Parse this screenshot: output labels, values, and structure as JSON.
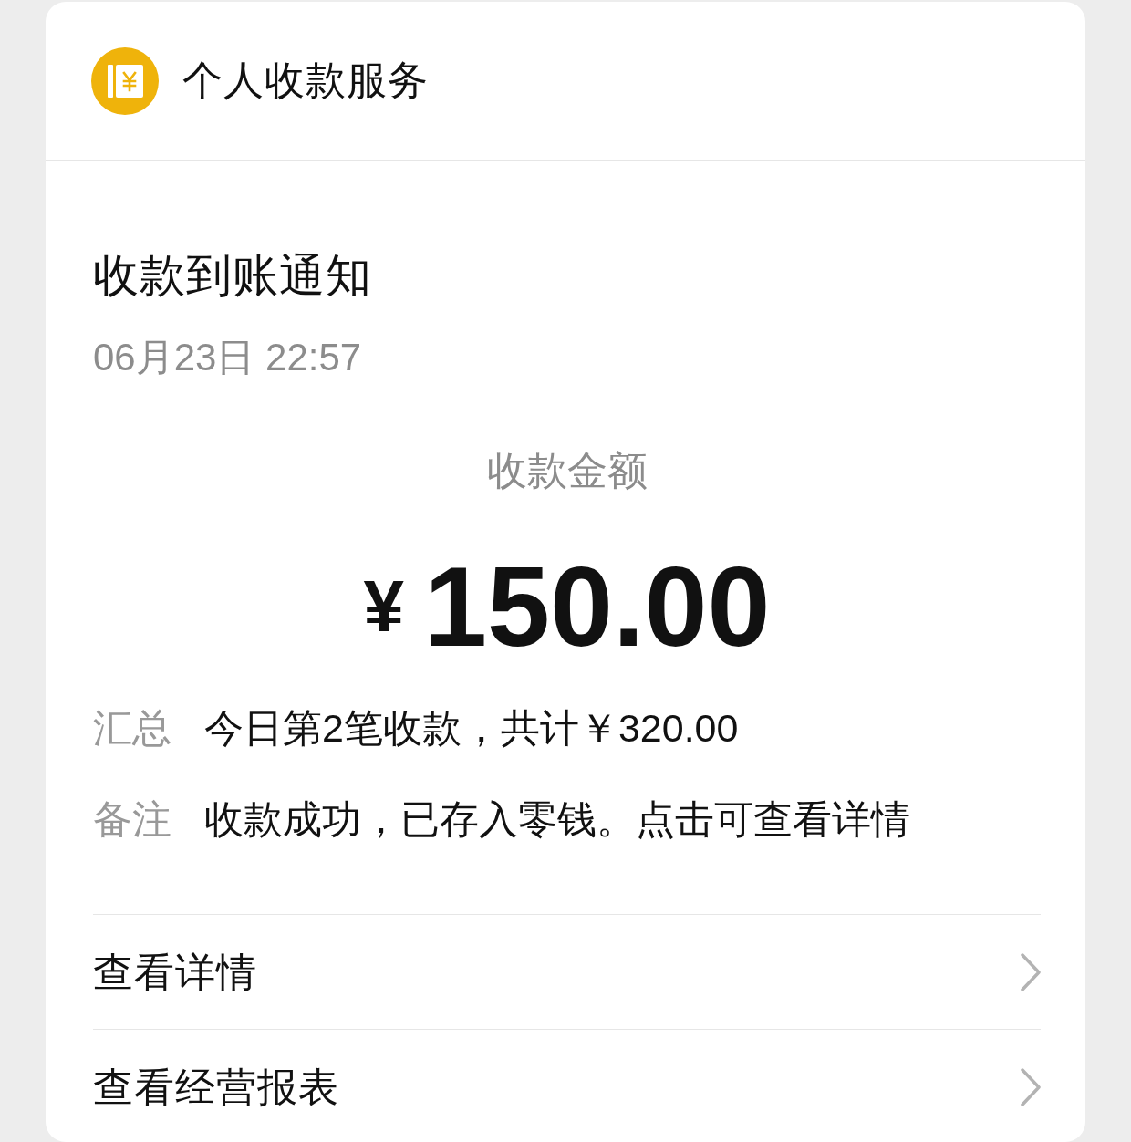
{
  "header": {
    "title": "个人收款服务"
  },
  "notice": {
    "title": "收款到账通知",
    "time": "06月23日 22:57",
    "amount_label": "收款金额",
    "currency": "¥",
    "amount": "150.00"
  },
  "details": [
    {
      "label": "汇总",
      "value": "今日第2笔收款，共计￥320.00"
    },
    {
      "label": "备注",
      "value": "收款成功，已存入零钱。点击可查看详情"
    }
  ],
  "links": [
    {
      "label": "查看详情"
    },
    {
      "label": "查看经营报表"
    }
  ]
}
